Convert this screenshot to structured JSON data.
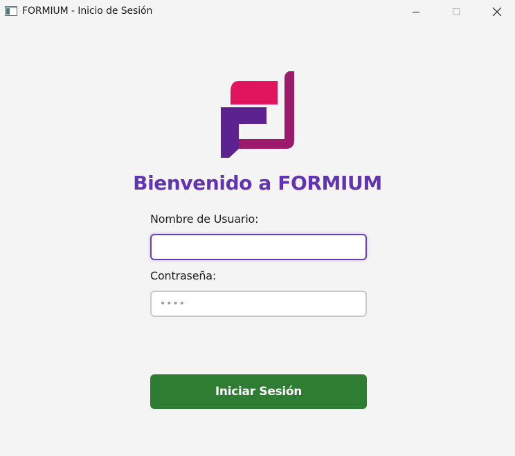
{
  "window": {
    "title": "FORMIUM - Inicio de Sesión",
    "controls": [
      "minimize",
      "maximize",
      "close"
    ]
  },
  "logo": {
    "icon": "formium-logo-icon",
    "colors": {
      "magenta": "#e0155e",
      "purple": "#5c2390",
      "plum": "#9c1a6a"
    }
  },
  "main": {
    "welcome": "Bienvenido a FORMIUM",
    "username_label": "Nombre de Usuario:",
    "username_value": "",
    "password_label": "Contraseña:",
    "password_placeholder": "••••",
    "login_button": "Iniciar Sesión"
  },
  "colors": {
    "accent": "#6233b2",
    "button": "#2e7d32",
    "focus_border": "#6a3fb5"
  }
}
